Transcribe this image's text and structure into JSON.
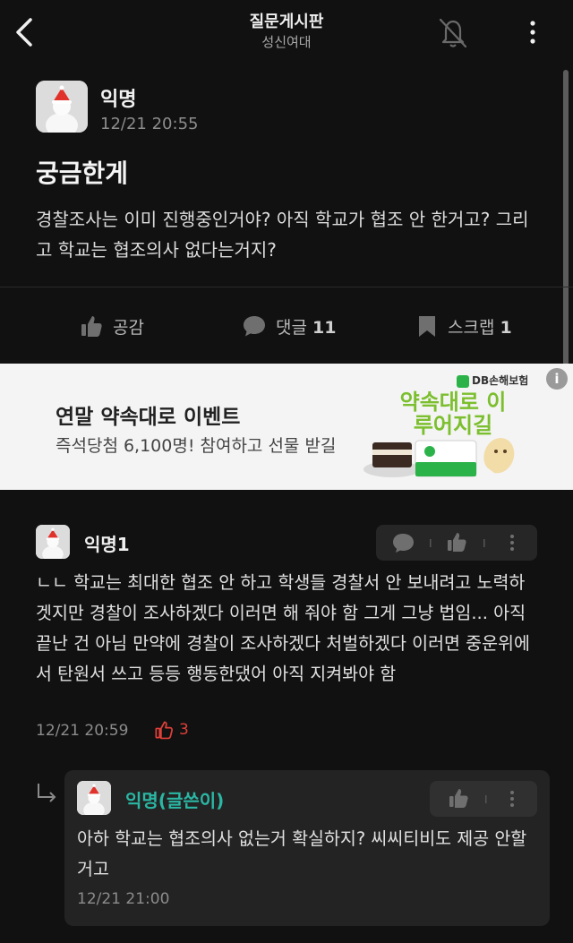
{
  "header": {
    "title": "질문게시판",
    "subtitle": "성신여대"
  },
  "post": {
    "author": "익명",
    "time": "12/21 20:55",
    "title": "궁금한게",
    "body": "경찰조사는 이미 진행중인거야? 아직 학교가 협조 안 한거고? 그리고 학교는 협조의사 없다는거지?",
    "actions": {
      "like_label": "공감",
      "comment_label": "댓글",
      "comment_count": "11",
      "scrap_label": "스크랩",
      "scrap_count": "1"
    }
  },
  "ad": {
    "title": "연말 약속대로 이벤트",
    "subtitle": "즉석당첨 6,100명! 참여하고 선물 받길",
    "brand": "DB손해보험",
    "slogan": "약속대로 이루어지길",
    "info_icon": "i"
  },
  "comments": [
    {
      "author": "익명1",
      "body": "ㄴㄴ 학교는 최대한 협조 안 하고 학생들 경찰서 안 보내려고 노력하겟지만 경찰이 조사하겠다 이러면 해 줘야 함 그게 그냥 법임... 아직 끝난 건 아님 만약에 경찰이 조사하겠다 처벌하겠다 이러면 중운위에서 탄원서 쓰고 등등 행동한댔어 아직 지켜봐야 함",
      "time": "12/21 20:59",
      "likes": "3"
    }
  ],
  "reply": {
    "author": "익명(글쓴이)",
    "body": "아하 학교는 협조의사 없는거 확실하지? 씨씨티비도 제공 안할거고",
    "time": "12/21 21:00"
  },
  "colors": {
    "background": "#111111",
    "writer_accent": "#2ab7a4",
    "like_red": "#e0403a",
    "ad_green": "#7cbf2e"
  }
}
